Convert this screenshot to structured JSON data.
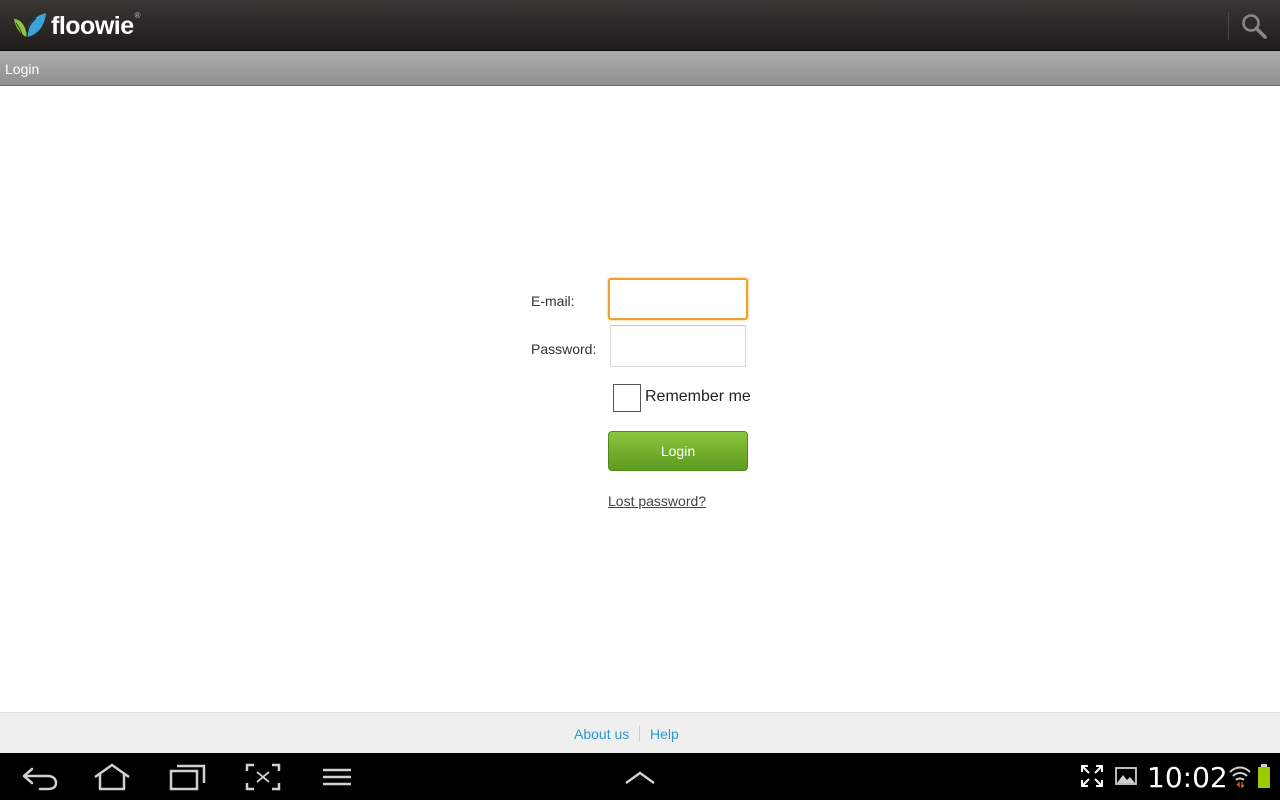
{
  "app": {
    "logo_text": "floowie",
    "logo_mark": "®"
  },
  "titlebar": {
    "title": "Login"
  },
  "form": {
    "email_label": "E-mail:",
    "email_value": "",
    "password_label": "Password:",
    "password_value": "",
    "remember_label": "Remember me",
    "remember_checked": false,
    "login_label": "Login",
    "lost_password_label": "Lost password?"
  },
  "footer": {
    "about_label": "About us",
    "help_label": "Help"
  },
  "status": {
    "time": "10:02"
  },
  "colors": {
    "focus_border": "#f0a030",
    "login_green": "#7ab32e",
    "link_blue": "#2b9bd0"
  },
  "icons": [
    "leaf-logo-icon",
    "search-icon",
    "back-icon",
    "home-icon",
    "recent-apps-icon",
    "screenshot-icon",
    "menu-icon",
    "chevron-up-icon",
    "fullscreen-icon",
    "gallery-icon",
    "wifi-icon",
    "battery-icon"
  ]
}
